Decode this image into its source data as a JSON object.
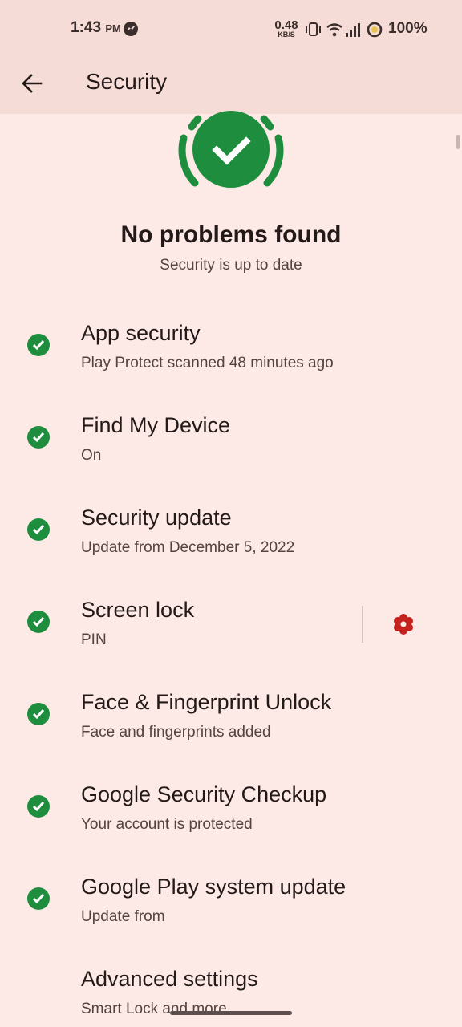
{
  "status_bar": {
    "time": "1:43",
    "ampm": "PM",
    "net_speed_value": "0.48",
    "net_speed_unit": "KB/S",
    "battery": "100%",
    "icons": [
      "messenger-icon",
      "vibrate-icon",
      "wifi-icon",
      "signal-icon",
      "battery-saver-icon"
    ]
  },
  "app_bar": {
    "title": "Security",
    "back_icon": "arrow-left-icon"
  },
  "hero": {
    "title": "No problems found",
    "subtitle": "Security is up to date",
    "status_color": "#1e8e3e"
  },
  "items": [
    {
      "title": "App security",
      "subtitle": "Play Protect scanned 48 minutes ago",
      "status": "ok"
    },
    {
      "title": "Find My Device",
      "subtitle": "On",
      "status": "ok"
    },
    {
      "title": "Security update",
      "subtitle": "Update from December 5, 2022",
      "status": "ok"
    },
    {
      "title": "Screen lock",
      "subtitle": "PIN",
      "status": "ok",
      "trailing_icon": "gear-icon"
    },
    {
      "title": "Face & Fingerprint Unlock",
      "subtitle": "Face and fingerprints added",
      "status": "ok"
    },
    {
      "title": "Google Security Checkup",
      "subtitle": "Your account is protected",
      "status": "ok"
    },
    {
      "title": "Google Play system update",
      "subtitle": "Update from",
      "status": "ok"
    },
    {
      "title": "Advanced settings",
      "subtitle": "Smart Lock and more"
    }
  ],
  "colors": {
    "background": "#fdeae6",
    "app_bar": "#f6dcd6",
    "check_green": "#1e8e3e",
    "gear_red": "#c5221f"
  }
}
